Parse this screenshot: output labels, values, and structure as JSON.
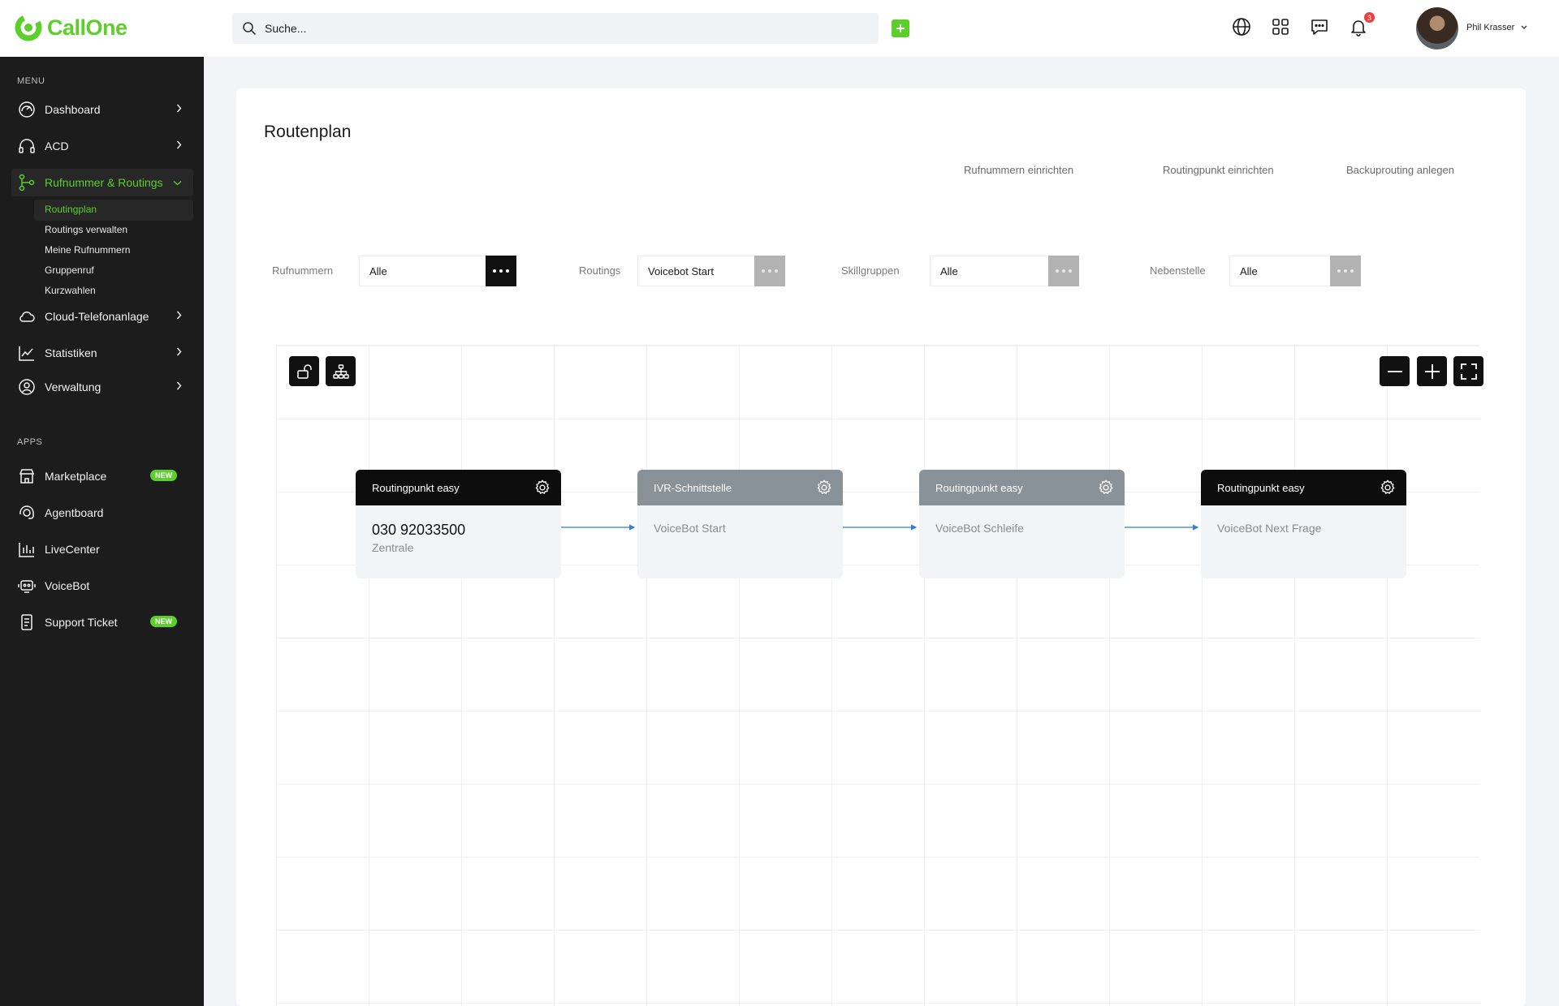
{
  "app": {
    "logo_text": "CallOne"
  },
  "topbar": {
    "search_placeholder": "Suche...",
    "notification_count": "3",
    "user_name": "Phil Krasser"
  },
  "sidebar": {
    "menu_label": "MENU",
    "apps_label": "APPS",
    "items": [
      {
        "label": "Dashboard"
      },
      {
        "label": "ACD"
      },
      {
        "label": "Rufnummer & Routings"
      },
      {
        "label": "Cloud-Telefonanlage"
      },
      {
        "label": "Statistiken"
      },
      {
        "label": "Verwaltung"
      }
    ],
    "sub_items": [
      {
        "label": "Routingplan"
      },
      {
        "label": "Routings verwalten"
      },
      {
        "label": "Meine Rufnummern"
      },
      {
        "label": "Gruppenruf"
      },
      {
        "label": "Kurzwahlen"
      }
    ],
    "apps": [
      {
        "label": "Marketplace",
        "badge": "NEW"
      },
      {
        "label": "Agentboard"
      },
      {
        "label": "LiveCenter"
      },
      {
        "label": "VoiceBot"
      },
      {
        "label": "Support Ticket",
        "badge": "NEW"
      }
    ]
  },
  "main": {
    "title": "Routenplan",
    "actions": [
      "Rufnummern einrichten",
      "Routingpunkt einrichten",
      "Backuprouting anlegen"
    ],
    "filters": [
      {
        "label": "Rufnummern",
        "value": "Alle"
      },
      {
        "label": "Routings",
        "value": "Voicebot Start"
      },
      {
        "label": "Skillgruppen",
        "value": "Alle"
      },
      {
        "label": "Nebenstelle",
        "value": "Alle"
      }
    ],
    "nodes": [
      {
        "title": "Routingpunkt easy",
        "number": "030 92033500",
        "subtitle": "Zentrale"
      },
      {
        "title": "IVR-Schnittstelle",
        "subtitle": "VoiceBot Start"
      },
      {
        "title": "Routingpunkt easy",
        "subtitle": "VoiceBot Schleife"
      },
      {
        "title": "Routingpunkt easy",
        "subtitle": "VoiceBot Next Frage"
      }
    ]
  },
  "colors": {
    "brand": "#5ccf2a",
    "sidebar_bg": "#1c1c1c",
    "edge": "#2f7fd8"
  }
}
